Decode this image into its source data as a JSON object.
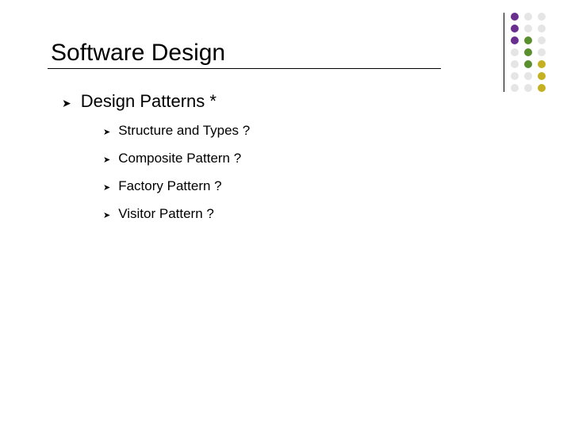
{
  "slide": {
    "title": "Software Design",
    "bullet_glyph": "➤",
    "level1": {
      "text": "Design Patterns *"
    },
    "level2": [
      {
        "text": "Structure and Types ?"
      },
      {
        "text": "Composite Pattern ?"
      },
      {
        "text": "Factory Pattern ?"
      },
      {
        "text": "Visitor Pattern ?"
      }
    ]
  },
  "decor": {
    "dot_columns": [
      [
        "#6a2e8f",
        "#6a2e8f",
        "#6a2e8f",
        "#e5e5e5",
        "#e5e5e5",
        "#e5e5e5",
        "#e5e5e5"
      ],
      [
        "#e5e5e5",
        "#e5e5e5",
        "#5a8f2e",
        "#5a8f2e",
        "#5a8f2e",
        "#e5e5e5",
        "#e5e5e5"
      ],
      [
        "#e5e5e5",
        "#e5e5e5",
        "#e5e5e5",
        "#e5e5e5",
        "#c4b020",
        "#c4b020",
        "#c4b020"
      ]
    ]
  }
}
